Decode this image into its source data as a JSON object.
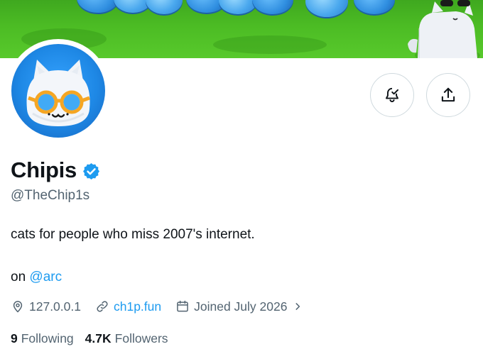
{
  "banner": {
    "icon": "cat-mascot-banner"
  },
  "profile": {
    "name": "Chipis",
    "handle": "@TheChip1s",
    "bio_line1": "cats for people who miss 2007's internet.",
    "bio_prefix": "on",
    "bio_mention": "@arc",
    "location": "127.0.0.1",
    "website": "ch1p.fun",
    "joined": "Joined July 2026",
    "following_count": "9",
    "following_label": "Following",
    "followers_count": "4.7K",
    "followers_label": "Followers"
  },
  "icons": {
    "verified": "verified-badge-icon",
    "notify": "bell-check-icon",
    "share": "share-upload-icon",
    "location": "location-pin-icon",
    "link": "link-icon",
    "calendar": "calendar-icon",
    "chevron": "chevron-right-icon"
  },
  "colors": {
    "accent": "#1d9bf0",
    "text": "#0f1419",
    "muted": "#536471",
    "border": "#cfd9de"
  }
}
